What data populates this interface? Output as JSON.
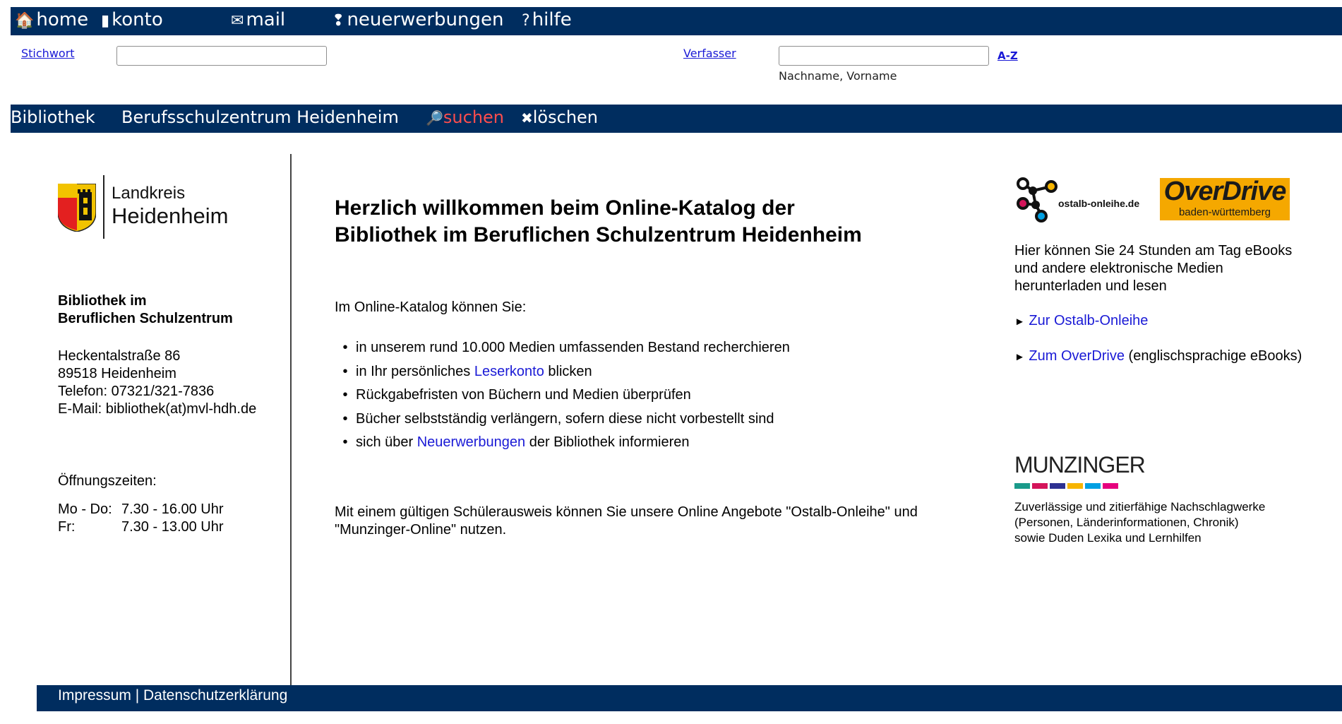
{
  "nav": {
    "items": [
      {
        "label": "home",
        "icon": "house-icon"
      },
      {
        "label": "konto",
        "icon": "account-icon"
      },
      {
        "label": "mail",
        "icon": "mail-icon"
      },
      {
        "label": "neuerwerbungen",
        "icon": "exclamation-icon"
      },
      {
        "label": "hilfe",
        "icon": "question-icon"
      }
    ],
    "icons": {
      "home": "🏠",
      "konto": "▮",
      "mail": "✉",
      "neuerwerbungen": "❢",
      "hilfe": "?"
    }
  },
  "search": {
    "stichwort_label": "Stichwort",
    "stichwort_value": "",
    "verfasser_label": "Verfasser",
    "verfasser_value": "",
    "az_label": "A-Z",
    "verfasser_hint": "Nachname, Vorname"
  },
  "subnav": {
    "library_label": "Bibliothek",
    "library_value": "Berufsschulzentrum Heidenheim",
    "search_button": "suchen",
    "clear_button": "löschen",
    "search_icon": "🔎",
    "clear_icon": "✖"
  },
  "left": {
    "logo_line1": "Landkreis",
    "logo_line2": "Heidenheim",
    "org_line1": "Bibliothek im",
    "org_line2": "Beruflichen Schulzentrum",
    "address": [
      "Heckentalstraße 86",
      "89518 Heidenheim",
      "Telefon: 07321/321-7836",
      "E-Mail: bibliothek(at)mvl-hdh.de"
    ],
    "hours_title": "Öffnungszeiten:",
    "hours": [
      {
        "days": "Mo - Do:",
        "time": "7.30 - 16.00 Uhr"
      },
      {
        "days": "Fr:",
        "time": "7.30 - 13.00 Uhr"
      }
    ]
  },
  "center": {
    "title_line1": "Herzlich willkommen beim Online-Katalog der",
    "title_line2": "Bibliothek im Beruflichen Schulzentrum Heidenheim",
    "intro": "Im Online-Katalog können Sie:",
    "items": {
      "i1": "in unserem rund 10.000 Medien umfassenden Bestand recherchieren",
      "i2_pre": "in Ihr persönliches ",
      "i2_link": "Leserkonto",
      "i2_post": " blicken",
      "i3": "Rückgabefristen von Büchern und Medien überprüfen",
      "i4": "Bücher selbstständig verlängern, sofern diese nicht vorbestellt sind",
      "i5_pre": "sich über ",
      "i5_link": "Neuerwerbungen",
      "i5_post": " der Bibliothek informieren",
      "bullet": "•"
    },
    "note": "Mit einem gültigen Schülerausweis können Sie unsere Online Angebote \"Ostalb-Onleihe\" und \"Munzinger-Online\" nutzen."
  },
  "right": {
    "onleihe_logo_text": "ostalb-onleihe.de",
    "overdrive_logo_text": "OverDrive",
    "overdrive_logo_sub": "baden-württemberg",
    "info": "Hier können Sie 24 Stunden am Tag eBooks und andere elektronische Medien herunterladen und lesen",
    "arrow": "►",
    "link1": "Zur Ostalb-Onleihe",
    "link2": "Zum OverDrive",
    "link2_post": " (englischsprachige eBooks)",
    "munzinger_logo": "MUNZINGER",
    "munzinger_desc_1": "Zuverlässige und zitierfähige Nachschlagwerke",
    "munzinger_desc_2": "(Personen, Länderinformationen, Chronik)",
    "munzinger_desc_3": "sowie Duden Lexika und Lernhilfen",
    "munzinger_colors": [
      "#1a9a8a",
      "#d4145a",
      "#2e3192",
      "#f7b500",
      "#00a0e3",
      "#e6007e"
    ]
  },
  "footer": {
    "impressum": "Impressum",
    "separator": " | ",
    "datenschutz": "Datenschutzerklärung"
  },
  "colors": {
    "nav_bg": "#002d5f",
    "search_button": "#ff4d4d",
    "link": "#1a1ad6"
  }
}
